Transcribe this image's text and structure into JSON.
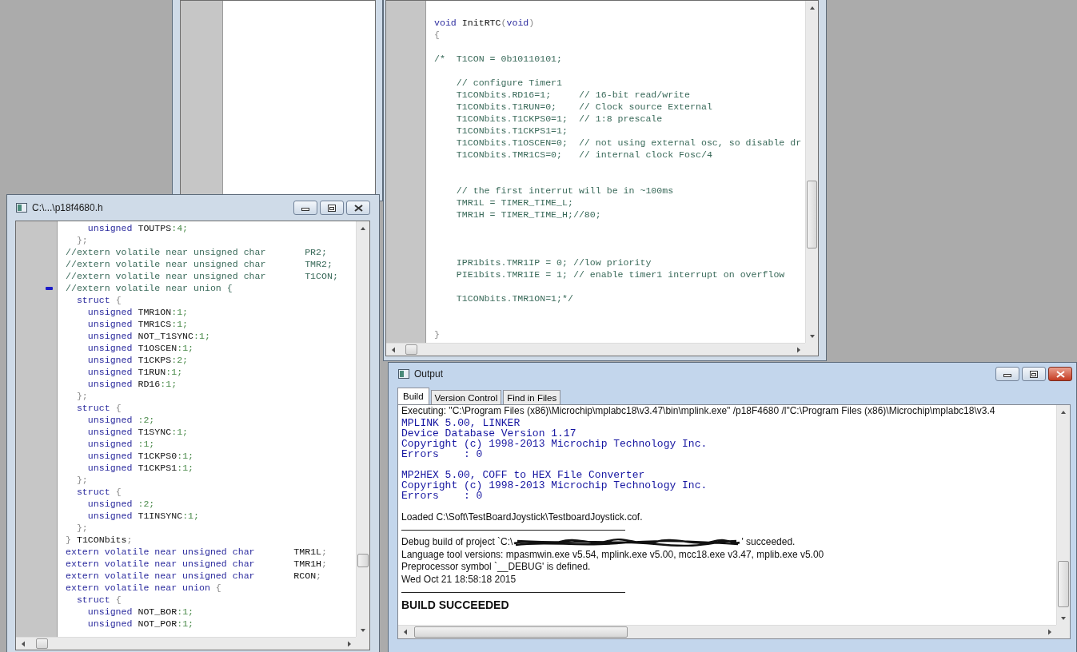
{
  "header_editor": {
    "title": "C:\\...\\p18f4680.h",
    "lines": [
      {
        "marked": false,
        "segments": [
          {
            "kind": "keyword",
            "text": "    unsigned"
          },
          {
            "kind": "plain",
            "text": " TOUTPS"
          },
          {
            "kind": "number",
            "text": ":4;"
          }
        ]
      },
      {
        "marked": false,
        "segments": [
          {
            "kind": "punct",
            "text": "  };"
          }
        ]
      },
      {
        "marked": false,
        "segments": [
          {
            "kind": "comment",
            "text": "//extern volatile near unsigned char       PR2;"
          }
        ]
      },
      {
        "marked": false,
        "segments": [
          {
            "kind": "comment",
            "text": "//extern volatile near unsigned char       TMR2;"
          }
        ]
      },
      {
        "marked": false,
        "segments": [
          {
            "kind": "comment",
            "text": "//extern volatile near unsigned char       T1CON;"
          }
        ]
      },
      {
        "marked": true,
        "segments": [
          {
            "kind": "comment",
            "text": "//extern volatile near union {"
          }
        ]
      },
      {
        "marked": false,
        "segments": [
          {
            "kind": "keyword",
            "text": "  struct"
          },
          {
            "kind": "punct",
            "text": " {"
          }
        ]
      },
      {
        "marked": false,
        "segments": [
          {
            "kind": "keyword",
            "text": "    unsigned"
          },
          {
            "kind": "plain",
            "text": " TMR1ON"
          },
          {
            "kind": "number",
            "text": ":1;"
          }
        ]
      },
      {
        "marked": false,
        "segments": [
          {
            "kind": "keyword",
            "text": "    unsigned"
          },
          {
            "kind": "plain",
            "text": " TMR1CS"
          },
          {
            "kind": "number",
            "text": ":1;"
          }
        ]
      },
      {
        "marked": false,
        "segments": [
          {
            "kind": "keyword",
            "text": "    unsigned"
          },
          {
            "kind": "plain",
            "text": " NOT_T1SYNC"
          },
          {
            "kind": "number",
            "text": ":1;"
          }
        ]
      },
      {
        "marked": false,
        "segments": [
          {
            "kind": "keyword",
            "text": "    unsigned"
          },
          {
            "kind": "plain",
            "text": " T1OSCEN"
          },
          {
            "kind": "number",
            "text": ":1;"
          }
        ]
      },
      {
        "marked": false,
        "segments": [
          {
            "kind": "keyword",
            "text": "    unsigned"
          },
          {
            "kind": "plain",
            "text": " T1CKPS"
          },
          {
            "kind": "number",
            "text": ":2;"
          }
        ]
      },
      {
        "marked": false,
        "segments": [
          {
            "kind": "keyword",
            "text": "    unsigned"
          },
          {
            "kind": "plain",
            "text": " T1RUN"
          },
          {
            "kind": "number",
            "text": ":1;"
          }
        ]
      },
      {
        "marked": false,
        "segments": [
          {
            "kind": "keyword",
            "text": "    unsigned"
          },
          {
            "kind": "plain",
            "text": " RD16"
          },
          {
            "kind": "number",
            "text": ":1;"
          }
        ]
      },
      {
        "marked": false,
        "segments": [
          {
            "kind": "punct",
            "text": "  };"
          }
        ]
      },
      {
        "marked": false,
        "segments": [
          {
            "kind": "keyword",
            "text": "  struct"
          },
          {
            "kind": "punct",
            "text": " {"
          }
        ]
      },
      {
        "marked": false,
        "segments": [
          {
            "kind": "keyword",
            "text": "    unsigned"
          },
          {
            "kind": "number",
            "text": " :2;"
          }
        ]
      },
      {
        "marked": false,
        "segments": [
          {
            "kind": "keyword",
            "text": "    unsigned"
          },
          {
            "kind": "plain",
            "text": " T1SYNC"
          },
          {
            "kind": "number",
            "text": ":1;"
          }
        ]
      },
      {
        "marked": false,
        "segments": [
          {
            "kind": "keyword",
            "text": "    unsigned"
          },
          {
            "kind": "number",
            "text": " :1;"
          }
        ]
      },
      {
        "marked": false,
        "segments": [
          {
            "kind": "keyword",
            "text": "    unsigned"
          },
          {
            "kind": "plain",
            "text": " T1CKPS0"
          },
          {
            "kind": "number",
            "text": ":1;"
          }
        ]
      },
      {
        "marked": false,
        "segments": [
          {
            "kind": "keyword",
            "text": "    unsigned"
          },
          {
            "kind": "plain",
            "text": " T1CKPS1"
          },
          {
            "kind": "number",
            "text": ":1;"
          }
        ]
      },
      {
        "marked": false,
        "segments": [
          {
            "kind": "punct",
            "text": "  };"
          }
        ]
      },
      {
        "marked": false,
        "segments": [
          {
            "kind": "keyword",
            "text": "  struct"
          },
          {
            "kind": "punct",
            "text": " {"
          }
        ]
      },
      {
        "marked": false,
        "segments": [
          {
            "kind": "keyword",
            "text": "    unsigned"
          },
          {
            "kind": "number",
            "text": " :2;"
          }
        ]
      },
      {
        "marked": false,
        "segments": [
          {
            "kind": "keyword",
            "text": "    unsigned"
          },
          {
            "kind": "plain",
            "text": " T1INSYNC"
          },
          {
            "kind": "number",
            "text": ":1;"
          }
        ]
      },
      {
        "marked": false,
        "segments": [
          {
            "kind": "punct",
            "text": "  };"
          }
        ]
      },
      {
        "marked": false,
        "segments": [
          {
            "kind": "punct",
            "text": "} "
          },
          {
            "kind": "plain",
            "text": "T1CONbits"
          },
          {
            "kind": "punct",
            "text": ";"
          }
        ]
      },
      {
        "marked": false,
        "segments": [
          {
            "kind": "keyword",
            "text": "extern volatile near unsigned char"
          },
          {
            "kind": "plain",
            "text": "       TMR1L"
          },
          {
            "kind": "punct",
            "text": ";"
          }
        ]
      },
      {
        "marked": false,
        "segments": [
          {
            "kind": "keyword",
            "text": "extern volatile near unsigned char"
          },
          {
            "kind": "plain",
            "text": "       TMR1H"
          },
          {
            "kind": "punct",
            "text": ";"
          }
        ]
      },
      {
        "marked": false,
        "segments": [
          {
            "kind": "keyword",
            "text": "extern volatile near unsigned char"
          },
          {
            "kind": "plain",
            "text": "       RCON"
          },
          {
            "kind": "punct",
            "text": ";"
          }
        ]
      },
      {
        "marked": false,
        "segments": [
          {
            "kind": "keyword",
            "text": "extern volatile near union"
          },
          {
            "kind": "punct",
            "text": " {"
          }
        ]
      },
      {
        "marked": false,
        "segments": [
          {
            "kind": "keyword",
            "text": "  struct"
          },
          {
            "kind": "punct",
            "text": " {"
          }
        ]
      },
      {
        "marked": false,
        "segments": [
          {
            "kind": "keyword",
            "text": "    unsigned"
          },
          {
            "kind": "plain",
            "text": " NOT_BOR"
          },
          {
            "kind": "number",
            "text": ":1;"
          }
        ]
      },
      {
        "marked": false,
        "segments": [
          {
            "kind": "keyword",
            "text": "    unsigned"
          },
          {
            "kind": "plain",
            "text": " NOT_POR"
          },
          {
            "kind": "number",
            "text": ":1;"
          }
        ]
      }
    ]
  },
  "source_editor": {
    "lines": [
      {
        "kind": "blank"
      },
      {
        "kind": "code",
        "segments": [
          {
            "kind": "keyword",
            "text": "void"
          },
          {
            "kind": "plain",
            "text": " InitRTC"
          },
          {
            "kind": "punct",
            "text": "("
          },
          {
            "kind": "keyword",
            "text": "void"
          },
          {
            "kind": "punct",
            "text": ")"
          }
        ]
      },
      {
        "kind": "code",
        "segments": [
          {
            "kind": "punct",
            "text": "{"
          }
        ]
      },
      {
        "kind": "blank"
      },
      {
        "kind": "code",
        "segments": [
          {
            "kind": "comment",
            "text": "/*  T1CON = 0b10110101;"
          }
        ]
      },
      {
        "kind": "blank"
      },
      {
        "kind": "code",
        "segments": [
          {
            "kind": "comment",
            "text": "    // configure Timer1"
          }
        ]
      },
      {
        "kind": "code",
        "segments": [
          {
            "kind": "comment",
            "text": "    T1CONbits.RD16=1;     // 16-bit read/write"
          }
        ]
      },
      {
        "kind": "code",
        "segments": [
          {
            "kind": "comment",
            "text": "    T1CONbits.T1RUN=0;    // Clock source External"
          }
        ]
      },
      {
        "kind": "code",
        "segments": [
          {
            "kind": "comment",
            "text": "    T1CONbits.T1CKPS0=1;  // 1:8 prescale"
          }
        ]
      },
      {
        "kind": "code",
        "segments": [
          {
            "kind": "comment",
            "text": "    T1CONbits.T1CKPS1=1;"
          }
        ]
      },
      {
        "kind": "code",
        "segments": [
          {
            "kind": "comment",
            "text": "    T1CONbits.T1OSCEN=0;  // not using external osc, so disable dr"
          }
        ]
      },
      {
        "kind": "code",
        "segments": [
          {
            "kind": "comment",
            "text": "    T1CONbits.TMR1CS=0;   // internal clock Fosc/4"
          }
        ]
      },
      {
        "kind": "blank"
      },
      {
        "kind": "blank"
      },
      {
        "kind": "code",
        "segments": [
          {
            "kind": "comment",
            "text": "    // the first interrut will be in ~100ms"
          }
        ]
      },
      {
        "kind": "code",
        "segments": [
          {
            "kind": "comment",
            "text": "    TMR1L = TIMER_TIME_L;"
          }
        ]
      },
      {
        "kind": "code",
        "segments": [
          {
            "kind": "comment",
            "text": "    TMR1H = TIMER_TIME_H;//80;"
          }
        ]
      },
      {
        "kind": "blank"
      },
      {
        "kind": "blank"
      },
      {
        "kind": "blank"
      },
      {
        "kind": "code",
        "segments": [
          {
            "kind": "comment",
            "text": "    IPR1bits.TMR1IP = 0; //low priority"
          }
        ]
      },
      {
        "kind": "code",
        "segments": [
          {
            "kind": "comment",
            "text": "    PIE1bits.TMR1IE = 1; // enable timer1 interrupt on overflow"
          }
        ]
      },
      {
        "kind": "blank"
      },
      {
        "kind": "code",
        "segments": [
          {
            "kind": "comment",
            "text": "    T1CONbits.TMR1ON=1;*/"
          }
        ]
      },
      {
        "kind": "blank"
      },
      {
        "kind": "blank"
      },
      {
        "kind": "code",
        "segments": [
          {
            "kind": "punct",
            "text": "}"
          }
        ]
      }
    ]
  },
  "output_window": {
    "title": "Output",
    "tabs": [
      {
        "label": "Build",
        "selected": true
      },
      {
        "label": "Version Control",
        "selected": false
      },
      {
        "label": "Find in Files",
        "selected": false
      }
    ],
    "lines": [
      {
        "kind": "text",
        "text": "Executing: \"C:\\Program Files (x86)\\Microchip\\mplabc18\\v3.47\\bin\\mplink.exe\" /p18F4680 /l\"C:\\Program Files (x86)\\Microchip\\mplabc18\\v3.4"
      },
      {
        "kind": "tool",
        "text": "MPLINK 5.00, LINKER"
      },
      {
        "kind": "tool",
        "text": "Device Database Version 1.17"
      },
      {
        "kind": "tool",
        "text": "Copyright (c) 1998-2013 Microchip Technology Inc."
      },
      {
        "kind": "tool",
        "text": "Errors    : 0"
      },
      {
        "kind": "blank"
      },
      {
        "kind": "tool",
        "text": "MP2HEX 5.00, COFF to HEX File Converter"
      },
      {
        "kind": "tool",
        "text": "Copyright (c) 1998-2013 Microchip Technology Inc."
      },
      {
        "kind": "tool",
        "text": "Errors    : 0"
      },
      {
        "kind": "blank"
      },
      {
        "kind": "text",
        "text": "Loaded C:\\Soft\\TestBoardJoystick\\TestboardJoystick.cof."
      },
      {
        "kind": "rule"
      },
      {
        "kind": "redacted",
        "before": "Debug build of project `C:\\",
        "after": "' succeeded."
      },
      {
        "kind": "text",
        "text": "Language tool versions: mpasmwin.exe v5.54, mplink.exe v5.00, mcc18.exe v3.47, mplib.exe v5.00"
      },
      {
        "kind": "text",
        "text": "Preprocessor symbol `__DEBUG' is defined."
      },
      {
        "kind": "text",
        "text": "Wed Oct 21 18:58:18 2015"
      },
      {
        "kind": "rule"
      },
      {
        "kind": "result",
        "text": "BUILD SUCCEEDED"
      }
    ]
  }
}
